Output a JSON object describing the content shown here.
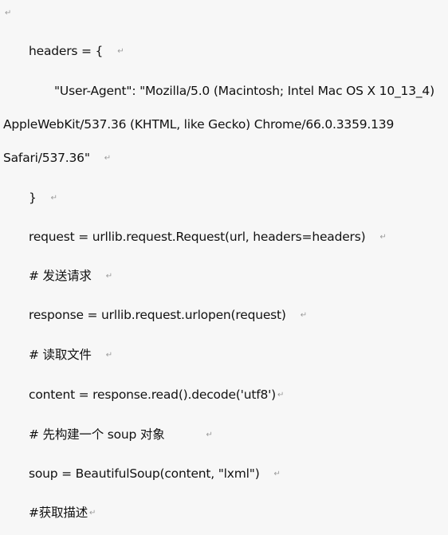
{
  "paragraph_mark": "↵",
  "lines": [
    {
      "text": ""
    },
    {
      "text": "headers = {"
    },
    {
      "text": "\"User-Agent\": \"Mozilla/5.0 (Macintosh; Intel Mac OS X 10_13_4)"
    },
    {
      "text": "AppleWebKit/537.36 (KHTML, like Gecko) Chrome/66.0.3359.139"
    },
    {
      "text": "Safari/537.36\""
    },
    {
      "text": "}"
    },
    {
      "text": "request = urllib.request.Request(url, headers=headers)"
    },
    {
      "text": "# 发送请求"
    },
    {
      "text": "response = urllib.request.urlopen(request)"
    },
    {
      "text": "# 读取文件"
    },
    {
      "text": "content = response.read().decode('utf8')"
    },
    {
      "text": "# 先构建一个 soup 对象"
    },
    {
      "text": "soup = BeautifulSoup(content, \"lxml\")"
    },
    {
      "text": "#获取描述"
    }
  ]
}
